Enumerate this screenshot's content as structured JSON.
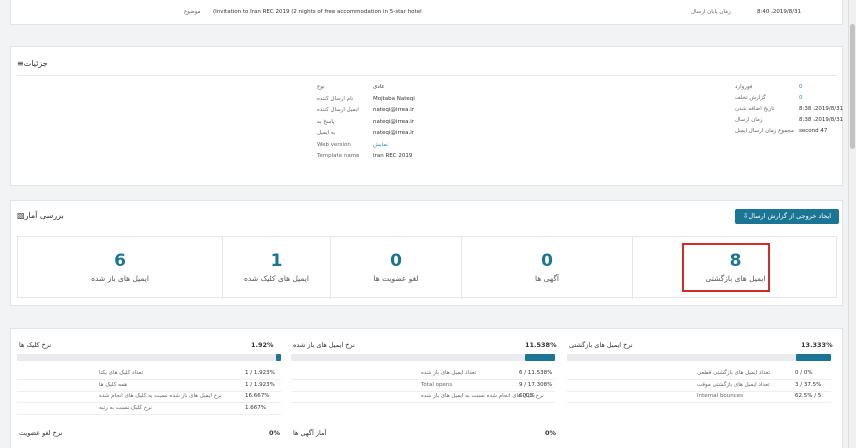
{
  "top": {
    "left_time1": "8:40 ،2019/8/31",
    "left_label1": "زمان پایان ارسال",
    "right_subject_value": "(Invitation to Iran REC 2019 (2 nights of free accommodation in 5-star hotel",
    "right_subject_label": "موضوع"
  },
  "details": {
    "title": "جزئیات",
    "left_col": [
      {
        "value": "0",
        "label": "فوروارد",
        "link": true
      },
      {
        "value": "0",
        "label": "گزارش تخلف",
        "link": true
      },
      {
        "value": "8:38 ،2019/8/31",
        "label": "تاریخ اضافه شدن"
      },
      {
        "value": "8:38 ،2019/8/31",
        "label": "زمان ارسال"
      },
      {
        "value": "second 47",
        "label": "مجموع زمان ارسال ایمیل"
      }
    ],
    "right_col": [
      {
        "value": "عادی",
        "label": "نوع"
      },
      {
        "value": "Mojtaba Nateqi",
        "label": "نام ارسال کننده"
      },
      {
        "value": "nateqi@irrea.ir",
        "label": "ایمیل ارسال کننده"
      },
      {
        "value": "nateqi@irrea.ir",
        "label": "پاسخ به"
      },
      {
        "value": "nateqi@irrea.ir",
        "label": "به ایمیل"
      },
      {
        "value": "نمایش",
        "label": "Web version",
        "link": true
      },
      {
        "value": "Iran REC 2019",
        "label": "Template name"
      }
    ]
  },
  "stats": {
    "title": "بررسی آمار",
    "export_button": "ایجاد خروجی از گزارش ارسال",
    "boxes": [
      {
        "num": "8",
        "label": "ایمیل های بازگشتی"
      },
      {
        "num": "0",
        "label": "آگهی ها"
      },
      {
        "num": "0",
        "label": "لغو عضویت ها"
      },
      {
        "num": "1",
        "label": "ایمیل های کلیک شده"
      },
      {
        "num": "6",
        "label": "ایمیل های باز شده"
      }
    ]
  },
  "rates": {
    "bounce": {
      "title": "نرخ ایمیل های بازگشتی",
      "pct": "13.333%",
      "fill": 0.133,
      "rows": [
        {
          "v": "0 / 0%",
          "l": "تعداد ایمیل های بازگشتی قطعی"
        },
        {
          "v": "3 / 37.5%",
          "l": "تعداد ایمیل های بازگشتی موقت"
        },
        {
          "v": "62.5% / 5",
          "l": "Internal bounces"
        }
      ]
    },
    "open": {
      "title": "نرخ ایمیل های باز شده",
      "pct": "11.538%",
      "fill": 0.115,
      "rows": [
        {
          "v": "6 / 11.538%",
          "l": "تعداد ایمیل های باز شده"
        },
        {
          "v": "9 / 17.308%",
          "l": "Total opens"
        },
        {
          "v": "600%",
          "l": "نرخ کلیک های انجام شده نسبت به ایمیل های باز شده"
        }
      ]
    },
    "click": {
      "title": "نرخ کلیک ها",
      "pct": "1.92%",
      "fill": 0.0192,
      "rows": [
        {
          "v": "1 / 1.923%",
          "l": "تعداد کلیک های یکتا"
        },
        {
          "v": "1 / 1.923%",
          "l": "همه کلیک ها"
        },
        {
          "v": "16.667%",
          "l": "نرخ ایمیل های باز شده نسبت به کلیک های انجام شده"
        },
        {
          "v": "1.667%",
          "l": "نرخ کلیک نسبت به رتبه"
        }
      ]
    },
    "ads": {
      "title": "آمار آگهی ها",
      "pct": "0%"
    },
    "unsub": {
      "title": "نرخ لغو عضویت",
      "pct": "0%"
    }
  }
}
